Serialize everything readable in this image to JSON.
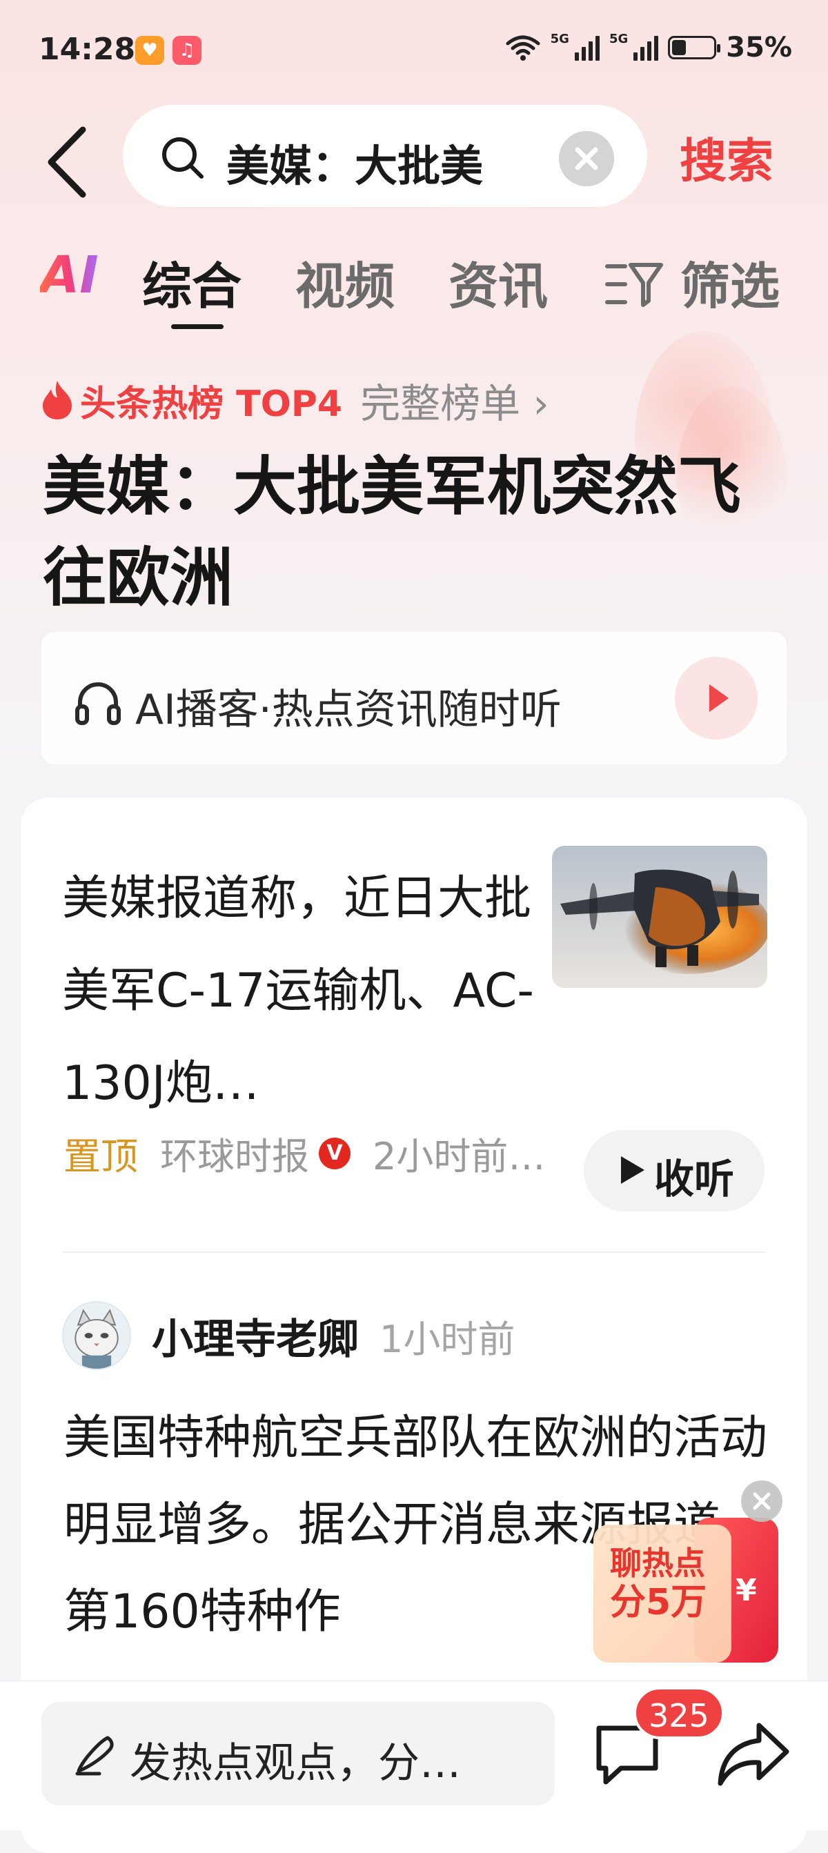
{
  "status_bar": {
    "time": "14:28",
    "network_1": "5G",
    "network_2": "5G",
    "battery_percent": "35%",
    "battery_level": 0.35
  },
  "search": {
    "query": "美媒：大批美",
    "button_label": "搜索"
  },
  "tabs": [
    {
      "label": "综合",
      "active": true
    },
    {
      "label": "视频",
      "active": false
    },
    {
      "label": "资讯",
      "active": false
    },
    {
      "label": "筛选",
      "active": false
    }
  ],
  "ai_tab_label": "AI",
  "hot": {
    "label": "头条热榜 TOP4",
    "more": "完整榜单 ›",
    "title": "美媒：大批美军机突然飞往欧洲"
  },
  "podcast": {
    "label": "AI播客·热点资讯随时听"
  },
  "article": {
    "title": "美媒报道称，近日大批美军C-17运输机、AC-130J炮…",
    "pin_label": "置顶",
    "source": "环球时报",
    "verified_badge": "V",
    "time": "2小时前…",
    "listen_label": "收听"
  },
  "post": {
    "author": "小理寺老卿",
    "time": "1小时前",
    "body": "美国特种航空兵部队在欧洲的活动明显增多。据公开消息来源报道，第160特种作"
  },
  "promo": {
    "line1": "聊热点",
    "line2": "分5万",
    "currency": "¥"
  },
  "bottom_bar": {
    "comment_placeholder": "发热点观点，分…",
    "comment_count": "325"
  },
  "colors": {
    "accent": "#f04142",
    "pin": "#d9961f",
    "verified": "#e3281f"
  }
}
